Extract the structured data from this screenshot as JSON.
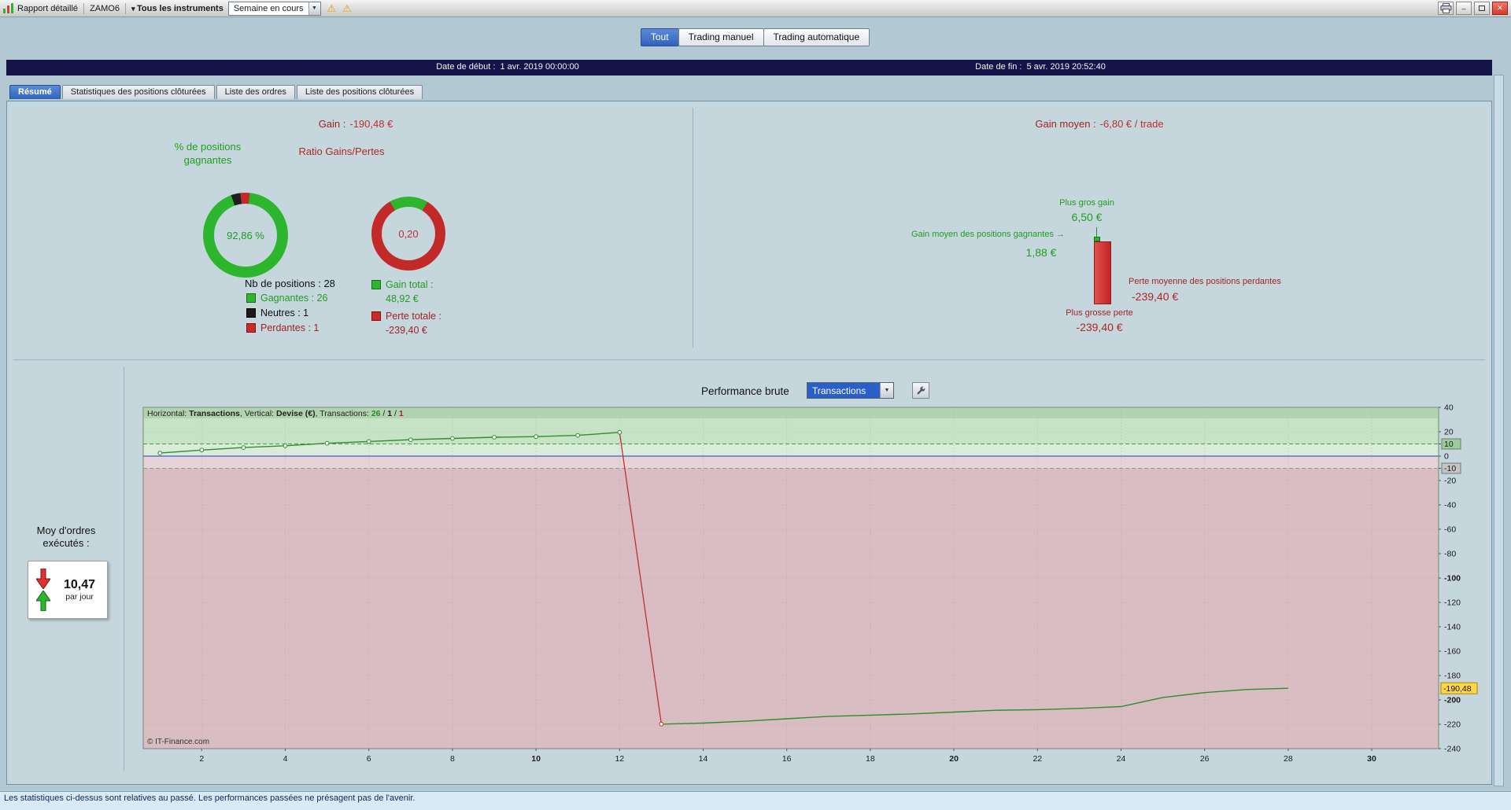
{
  "titlebar": {
    "title": "Rapport détaillé",
    "account": "ZAMO6",
    "instrument_filter": "Tous les instruments",
    "period_value": "Semaine en cours"
  },
  "view_tabs": [
    {
      "label": "Tout",
      "active": true
    },
    {
      "label": "Trading manuel",
      "active": false
    },
    {
      "label": "Trading automatique",
      "active": false
    }
  ],
  "dates": {
    "start_label": "Date de début :",
    "start_value": "1 avr. 2019 00:00:00",
    "end_label": "Date de fin :",
    "end_value": "5 avr. 2019 20:52:40"
  },
  "report_tabs": [
    {
      "label": "Résumé",
      "active": true
    },
    {
      "label": "Statistiques des positions clôturées",
      "active": false
    },
    {
      "label": "Liste des ordres",
      "active": false
    },
    {
      "label": "Liste des positions clôturées",
      "active": false
    }
  ],
  "summary": {
    "gain_label": "Gain :",
    "gain_value": "-190,48 €",
    "nb_positions": "Nb de positions : 28",
    "legend_gagnantes": "Gagnantes : 26",
    "legend_neutres": "Neutres : 1",
    "legend_perdantes": "Perdantes : 1",
    "gain_total_label": "Gain total :",
    "gain_total_value": "48,92 €",
    "perte_totale_label": "Perte totale :",
    "perte_totale_value": "-239,40 €"
  },
  "average": {
    "label": "Gain moyen :",
    "value": "-6,80 € / trade",
    "plus_gros_gain_label": "Plus gros gain",
    "plus_gros_gain_value": "6,50 €",
    "gain_moyen_gagnantes_label": "Gain moyen des positions gagnantes →",
    "gain_moyen_gagnantes_value": "1,88 €",
    "perte_moyenne_label": "Perte moyenne des positions perdantes",
    "perte_moyenne_value": "-239,40 €",
    "plus_grosse_perte_label": "Plus grosse perte",
    "plus_grosse_perte_value": "-239,40 €"
  },
  "performance": {
    "label": "Performance brute",
    "selector_value": "Transactions"
  },
  "orders_box": {
    "title": "Moy d'ordres exécutés :",
    "value": "10,47",
    "unit": "par jour"
  },
  "statusbar": {
    "text": "Les statistiques ci-dessus sont relatives au passé. Les performances passées ne présagent pas de l'avenir."
  },
  "colors": {
    "accent_blue": "#2f63be",
    "positive_green": "#1f9e1f",
    "negative_red": "#c03030",
    "dark_red": "#9e2424",
    "highlight_yellow": "#ffd64a",
    "chart_green_zone": "#c7e3c6",
    "chart_pink_zone": "#d9bdc2"
  },
  "chart_data": [
    {
      "type": "pie",
      "name": "pct_positions_gagnantes",
      "title": "% de positions gagnantes",
      "center_label": "92,86 %",
      "rotate": -20,
      "segments": [
        {
          "label": "Neutres",
          "count": 1,
          "value": 3.57,
          "color": "#1f1f1f"
        },
        {
          "label": "Perdantes",
          "count": 1,
          "value": 3.57,
          "color": "#c22a2a"
        },
        {
          "label": "Gagnantes",
          "count": 26,
          "value": 92.86,
          "color": "#2db52d"
        }
      ]
    },
    {
      "type": "pie",
      "name": "ratio_gains_pertes",
      "title": "Ratio Gains/Pertes",
      "center_label": "0,20",
      "rotate": -30,
      "segments": [
        {
          "label": "Gains (48,92 €)",
          "value": 16.96,
          "color": "#2db52d"
        },
        {
          "label": "Pertes (-239,40 €)",
          "value": 83.04,
          "color": "#c22a2a"
        }
      ]
    },
    {
      "type": "line",
      "name": "performance_brute_equity",
      "title": "Performance brute",
      "xlabel": "Transactions",
      "ylabel": "Devise (€)",
      "transactions_counts": {
        "gagnantes": 26,
        "neutres": 1,
        "perdantes": 1
      },
      "header_parts": [
        {
          "text": "Horizontal: ",
          "bold": false,
          "color": "#222222"
        },
        {
          "text": "Transactions",
          "bold": true,
          "color": "#222222"
        },
        {
          "text": ", Vertical: ",
          "bold": false,
          "color": "#222222"
        },
        {
          "text": "Devise (€)",
          "bold": true,
          "color": "#222222"
        },
        {
          "text": ", Transactions: ",
          "bold": false,
          "color": "#222222"
        },
        {
          "text": "26",
          "bold": true,
          "color": "#1f8f1f"
        },
        {
          "text": " / ",
          "bold": false,
          "color": "#222222"
        },
        {
          "text": "1",
          "bold": true,
          "color": "#222222"
        },
        {
          "text": " / ",
          "bold": false,
          "color": "#222222"
        },
        {
          "text": "1",
          "bold": true,
          "color": "#b22020"
        }
      ],
      "xlim": [
        0.6,
        31.6
      ],
      "ylim": [
        -240,
        40
      ],
      "x_ticks": [
        2,
        4,
        6,
        8,
        10,
        12,
        14,
        16,
        18,
        20,
        22,
        24,
        26,
        28,
        30
      ],
      "x_ticks_bold": [
        10,
        20,
        30
      ],
      "y_ticks": [
        40,
        20,
        10,
        0,
        -10,
        -20,
        -40,
        -60,
        -80,
        -100,
        -120,
        -140,
        -160,
        -180,
        -200,
        -220,
        -240
      ],
      "y_ticks_bold": [
        -100,
        -200
      ],
      "y_tick_boxes": {
        "10": "#98cf98",
        "-10": "#c4c4c4"
      },
      "upper_threshold": 10,
      "lower_threshold": -10,
      "zero_line": 0,
      "current_value": -190.48,
      "current_value_label": "-190,48",
      "copyright": "© IT-Finance.com",
      "x": [
        1,
        2,
        3,
        4,
        5,
        6,
        7,
        8,
        9,
        10,
        11,
        12,
        13,
        14,
        15,
        16,
        17,
        18,
        19,
        20,
        21,
        22,
        23,
        24,
        25,
        26,
        27,
        28
      ],
      "y": [
        2.5,
        5,
        7,
        8.5,
        10.5,
        12,
        13.5,
        14.5,
        15.5,
        16,
        17,
        19.5,
        -219.9,
        -219,
        -217.5,
        -215.5,
        -213.5,
        -212.5,
        -211.5,
        -210,
        -208.5,
        -208,
        -207,
        -205.5,
        -198,
        -194,
        -191.5,
        -190.48
      ],
      "loss_segment_from_x": 12
    }
  ]
}
